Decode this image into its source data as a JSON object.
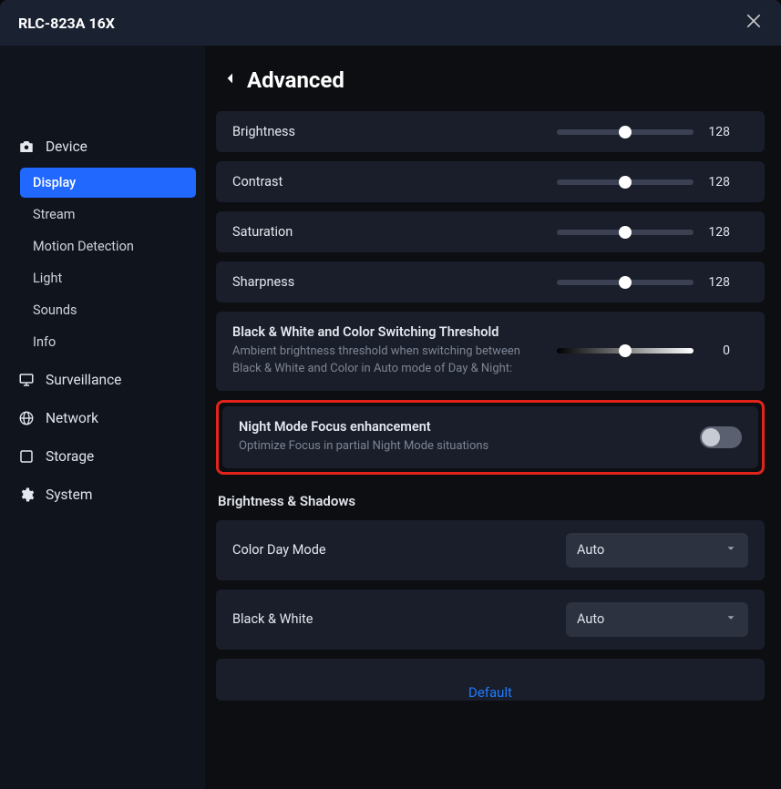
{
  "title": "RLC-823A 16X",
  "sidebar": {
    "sections": [
      {
        "label": "Device"
      },
      {
        "label": "Surveillance"
      },
      {
        "label": "Network"
      },
      {
        "label": "Storage"
      },
      {
        "label": "System"
      }
    ],
    "device_items": [
      "Display",
      "Stream",
      "Motion Detection",
      "Light",
      "Sounds",
      "Info"
    ]
  },
  "page": {
    "title": "Advanced",
    "sliders": {
      "brightness": {
        "label": "Brightness",
        "value": "128",
        "pct": 50
      },
      "contrast": {
        "label": "Contrast",
        "value": "128",
        "pct": 50
      },
      "saturation": {
        "label": "Saturation",
        "value": "128",
        "pct": 50
      },
      "sharpness": {
        "label": "Sharpness",
        "value": "128",
        "pct": 50
      }
    },
    "threshold": {
      "title": "Black & White and Color Switching Threshold",
      "desc": "Ambient brightness threshold when switching between Black & White and Color in Auto mode of Day & Night:",
      "value": "0",
      "pct": 50
    },
    "night_focus": {
      "title": "Night Mode Focus enhancement",
      "desc": "Optimize Focus in partial Night Mode situations"
    },
    "brightness_shadows": {
      "title": "Brightness & Shadows",
      "color_day": {
        "label": "Color Day Mode",
        "value": "Auto"
      },
      "bw": {
        "label": "Black & White",
        "value": "Auto"
      }
    },
    "default_btn": "Default"
  }
}
